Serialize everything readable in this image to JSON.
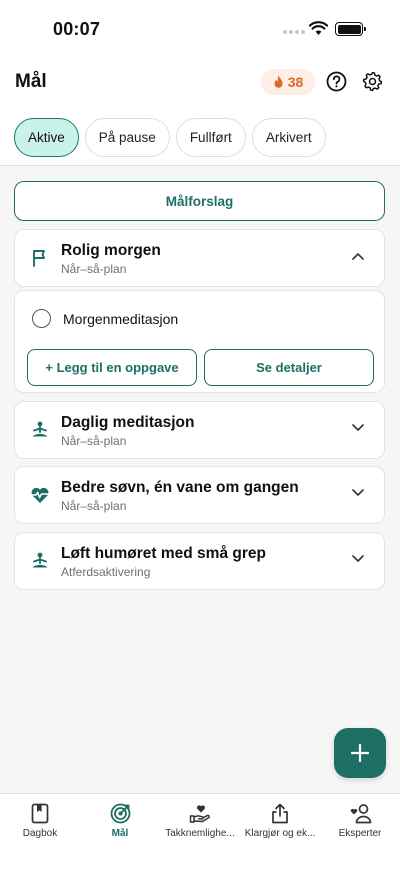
{
  "status_bar": {
    "time": "00:07"
  },
  "header": {
    "title": "Mål",
    "streak_count": "38"
  },
  "tabs": [
    {
      "label": "Aktive",
      "active": true
    },
    {
      "label": "På pause",
      "active": false
    },
    {
      "label": "Fullført",
      "active": false
    },
    {
      "label": "Arkivert",
      "active": false
    }
  ],
  "suggest_button": "Målforslag",
  "goals": [
    {
      "title": "Rolig morgen",
      "subtitle": "Når–så-plan",
      "icon": "flag-icon",
      "expanded": true
    },
    {
      "title": "Daglig meditasjon",
      "subtitle": "Når–så-plan",
      "icon": "meditation-icon",
      "expanded": false
    },
    {
      "title": "Bedre søvn, én vane om gangen",
      "subtitle": "Når–så-plan",
      "icon": "heart-pulse-icon",
      "expanded": false
    },
    {
      "title": "Løft humøret med små grep",
      "subtitle": "Atferdsaktivering",
      "icon": "meditation-icon",
      "expanded": false
    }
  ],
  "expanded_goal": {
    "tasks": [
      {
        "label": "Morgenmeditasjon",
        "done": false
      }
    ],
    "add_task_button": "+ Legg til en oppgave",
    "details_button": "Se detaljer"
  },
  "bottom_nav": [
    {
      "label": "Dagbok",
      "icon": "journal-icon",
      "active": false
    },
    {
      "label": "Mål",
      "icon": "target-icon",
      "active": true
    },
    {
      "label": "Takknemlighe...",
      "icon": "gratitude-icon",
      "active": false
    },
    {
      "label": "Klargjør og ek...",
      "icon": "share-icon",
      "active": false
    },
    {
      "label": "Eksperter",
      "icon": "experts-icon",
      "active": false
    }
  ],
  "colors": {
    "accent": "#1d6f66",
    "active_tab_bg": "#c9f3e8",
    "streak": "#e0672c"
  }
}
